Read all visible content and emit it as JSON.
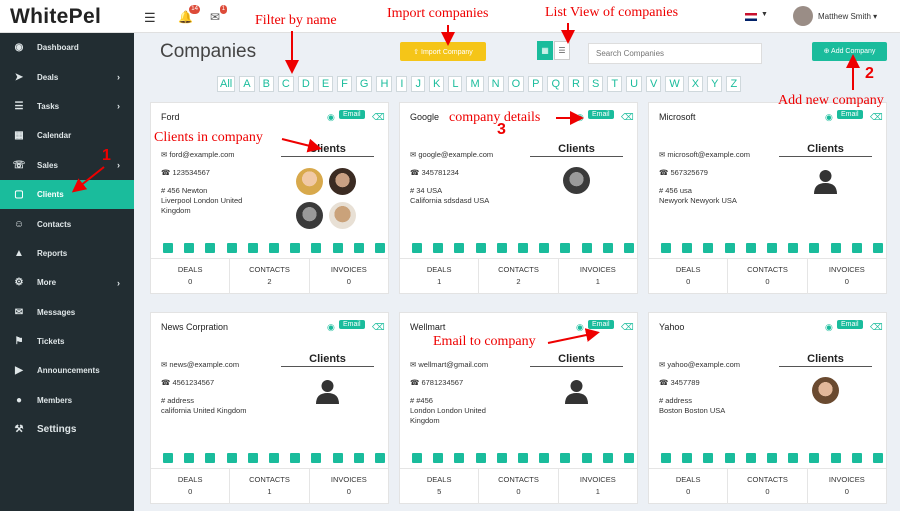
{
  "brand": "WhitePel",
  "topbar": {
    "notif_count": "14",
    "mail_count": "1",
    "user_name": "Matthew Smith"
  },
  "sidebar": [
    {
      "label": "Dashboard",
      "icon": "dashboard-icon",
      "chev": false
    },
    {
      "label": "Deals",
      "icon": "rocket-icon",
      "chev": true
    },
    {
      "label": "Tasks",
      "icon": "tasks-icon",
      "chev": true
    },
    {
      "label": "Calendar",
      "icon": "calendar-icon",
      "chev": false
    },
    {
      "label": "Sales",
      "icon": "cart-icon",
      "chev": true
    },
    {
      "label": "Clients",
      "icon": "building-icon",
      "chev": false,
      "active": true
    },
    {
      "label": "Contacts",
      "icon": "users-icon",
      "chev": false
    },
    {
      "label": "Reports",
      "icon": "chart-icon",
      "chev": false
    },
    {
      "label": "More",
      "icon": "gear-icon",
      "chev": true
    },
    {
      "label": "Messages",
      "icon": "envelope-icon",
      "chev": false
    },
    {
      "label": "Tickets",
      "icon": "ticket-icon",
      "chev": false
    },
    {
      "label": "Announcements",
      "icon": "bullhorn-icon",
      "chev": false
    },
    {
      "label": "Members",
      "icon": "user-icon",
      "chev": false
    },
    {
      "label": "Settings",
      "icon": "wrench-icon",
      "chev": false
    }
  ],
  "page": {
    "title": "Companies",
    "import_label": "Import Company",
    "search_placeholder": "Search Companies",
    "add_label": "Add Company",
    "letters": [
      "All",
      "A",
      "B",
      "C",
      "D",
      "E",
      "F",
      "G",
      "H",
      "I",
      "J",
      "K",
      "L",
      "M",
      "N",
      "O",
      "P",
      "Q",
      "R",
      "S",
      "T",
      "U",
      "V",
      "W",
      "X",
      "Y",
      "Z"
    ]
  },
  "labels": {
    "email": "Email",
    "clients": "Clients",
    "deals": "DEALS",
    "contacts": "CONTACTS",
    "invoices": "INVOICES"
  },
  "companies": [
    {
      "name": "Ford",
      "email": "ford@example.com",
      "phone": "123534567",
      "addr1": "456 Newton",
      "addr2": "Liverpool London United",
      "addr3": "Kingdom",
      "deals": "0",
      "contacts": "2",
      "invoices": "0",
      "clients": [
        "woman-blonde",
        "man-dark",
        "man-bw",
        "man-bald"
      ]
    },
    {
      "name": "Google",
      "email": "google@example.com",
      "phone": "345781234",
      "addr1": "34 USA",
      "addr2": "California sdsdasd USA",
      "addr3": "",
      "deals": "1",
      "contacts": "2",
      "invoices": "1",
      "clients": [
        "man-bw"
      ]
    },
    {
      "name": "Microsoft",
      "email": "microsoft@example.com",
      "phone": "567325679",
      "addr1": "456 usa",
      "addr2": "Newyork Newyork USA",
      "addr3": "",
      "deals": "0",
      "contacts": "0",
      "invoices": "0",
      "clients": [
        "silhouette"
      ]
    },
    {
      "name": "News Corpration",
      "email": "news@example.com",
      "phone": "4561234567",
      "addr1": "address",
      "addr2": "california United Kingdom",
      "addr3": "",
      "deals": "0",
      "contacts": "1",
      "invoices": "0",
      "clients": [
        "silhouette"
      ]
    },
    {
      "name": "Wellmart",
      "email": "wellmart@gmail.com",
      "phone": "6781234567",
      "addr1": "#456",
      "addr2": "London London United",
      "addr3": "Kingdom",
      "deals": "5",
      "contacts": "0",
      "invoices": "1",
      "clients": [
        "silhouette"
      ]
    },
    {
      "name": "Yahoo",
      "email": "yahoo@example.com",
      "phone": "3457789",
      "addr1": "address",
      "addr2": "Boston Boston USA",
      "addr3": "",
      "deals": "0",
      "contacts": "0",
      "invoices": "0",
      "clients": [
        "man-young"
      ]
    }
  ],
  "annotations": {
    "filter": "Filter by name",
    "import": "Import companies",
    "list": "List View of companies",
    "clients": "Clients in company",
    "details": "company details",
    "add": "Add new company",
    "email": "Email to company",
    "n1": "1",
    "n2": "2",
    "n3": "3"
  },
  "colors": {
    "accent": "#1abc9c",
    "sidebar": "#222d32",
    "import": "#f5c518",
    "annotation": "#e00000"
  }
}
